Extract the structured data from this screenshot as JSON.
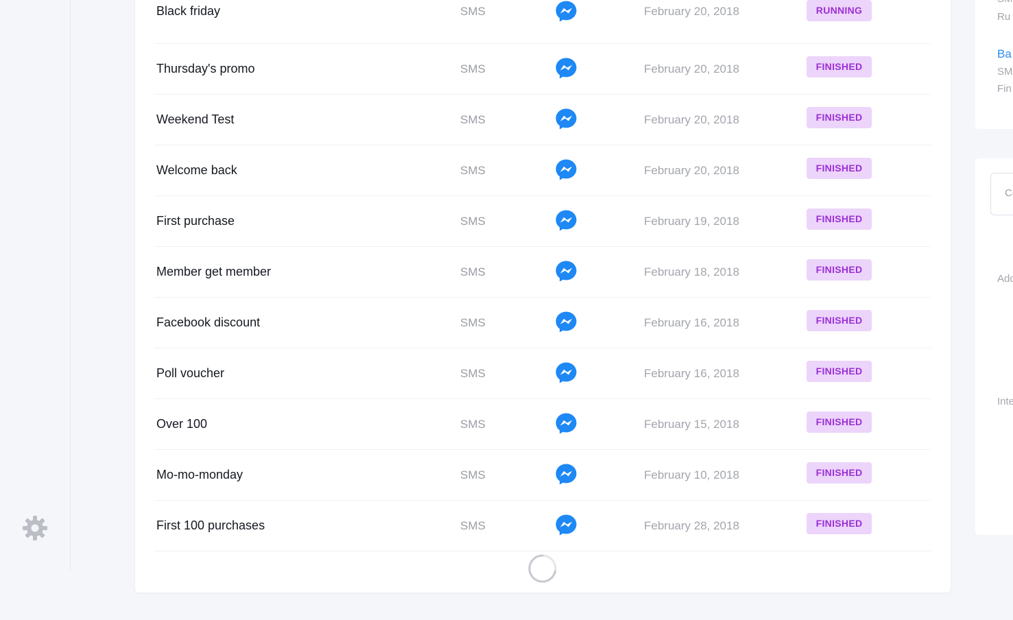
{
  "campaigns": [
    {
      "name": "Black friday",
      "channel": "SMS",
      "date": "February 20, 2018",
      "status": "RUNNING"
    },
    {
      "name": "Thursday's promo",
      "channel": "SMS",
      "date": "February 20, 2018",
      "status": "FINISHED"
    },
    {
      "name": "Weekend Test",
      "channel": "SMS",
      "date": "February 20, 2018",
      "status": "FINISHED"
    },
    {
      "name": "Welcome back",
      "channel": "SMS",
      "date": "February 20, 2018",
      "status": "FINISHED"
    },
    {
      "name": "First purchase",
      "channel": "SMS",
      "date": "February 19, 2018",
      "status": "FINISHED"
    },
    {
      "name": "Member get member",
      "channel": "SMS",
      "date": "February 18, 2018",
      "status": "FINISHED"
    },
    {
      "name": "Facebook discount",
      "channel": "SMS",
      "date": "February 16, 2018",
      "status": "FINISHED"
    },
    {
      "name": "Poll voucher",
      "channel": "SMS",
      "date": "February 16, 2018",
      "status": "FINISHED"
    },
    {
      "name": "Over 100",
      "channel": "SMS",
      "date": "February 15, 2018",
      "status": "FINISHED"
    },
    {
      "name": "Mo-mo-monday",
      "channel": "SMS",
      "date": "February 10, 2018",
      "status": "FINISHED"
    },
    {
      "name": "First 100 purchases",
      "channel": "SMS",
      "date": "February 28, 2018",
      "status": "FINISHED"
    }
  ],
  "icons": {
    "settings": "gear-icon",
    "channel": "messenger-icon",
    "loading": "spinner-icon"
  },
  "colors": {
    "messenger": "#1e88f5",
    "badge_bg": "#ecd4fa",
    "badge_text": "#9b2fd6",
    "link": "#2d8cf0"
  },
  "side_panel": {
    "top_cut_1": "SM",
    "top_cut_2": "Ru",
    "link_cut": "Ba",
    "channel_cut": "SM",
    "status_cut": "Fin",
    "input_cut": "Co",
    "label_cut_1": "Add",
    "label_cut_2": "Inte"
  }
}
